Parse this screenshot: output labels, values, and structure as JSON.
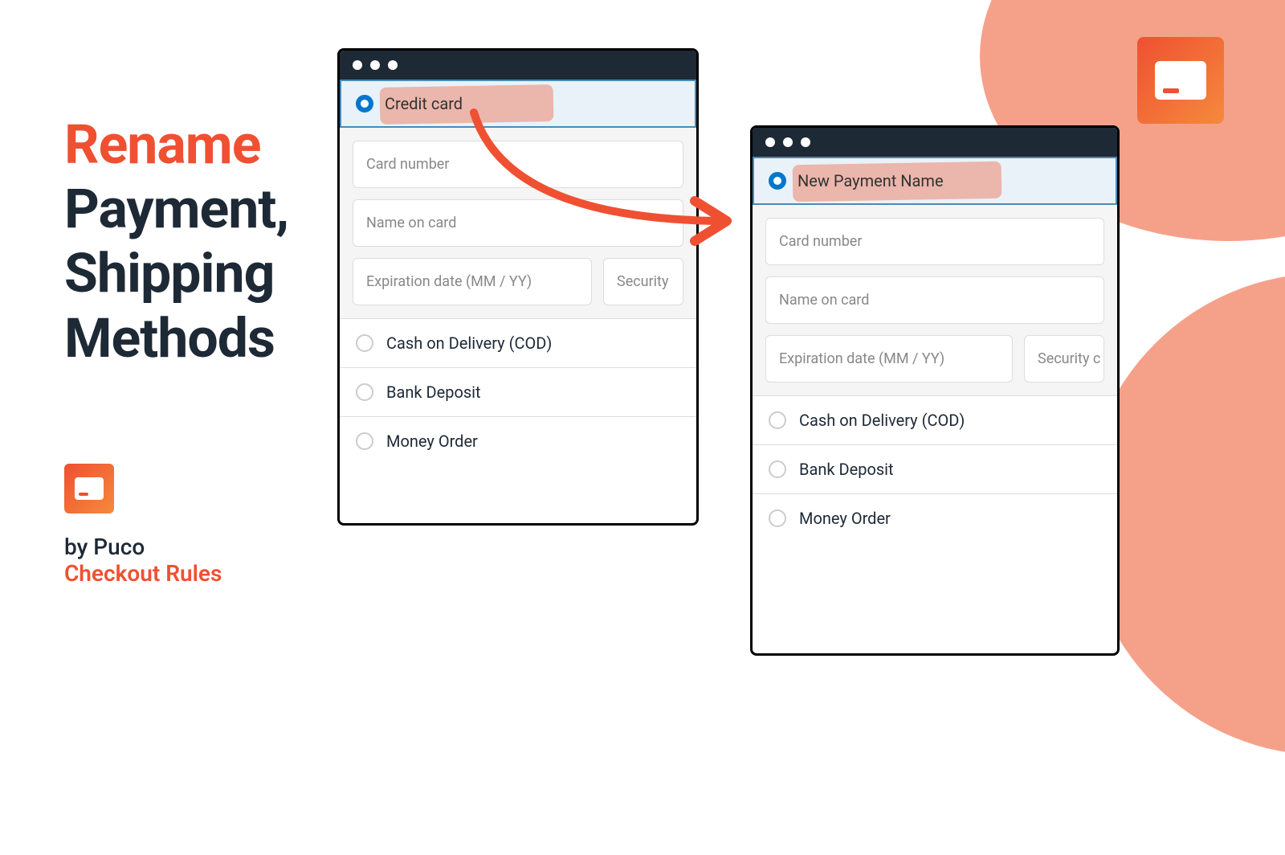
{
  "headline": {
    "line1": "Rename",
    "line2": "Payment,",
    "line3": "Shipping",
    "line4": "Methods"
  },
  "byline": {
    "top": "by Puco",
    "bottom": "Checkout Rules"
  },
  "window_left": {
    "selected_label": "Credit card",
    "fields": {
      "card_number": "Card number",
      "name_on_card": "Name on card",
      "expiration": "Expiration date (MM / YY)",
      "security": "Security"
    },
    "options": [
      "Cash on Delivery (COD)",
      "Bank Deposit",
      "Money Order"
    ]
  },
  "window_right": {
    "selected_label": "New Payment Name",
    "fields": {
      "card_number": "Card number",
      "name_on_card": "Name on card",
      "expiration": "Expiration date (MM / YY)",
      "security": "Security c"
    },
    "options": [
      "Cash on Delivery (COD)",
      "Bank Deposit",
      "Money Order"
    ]
  }
}
